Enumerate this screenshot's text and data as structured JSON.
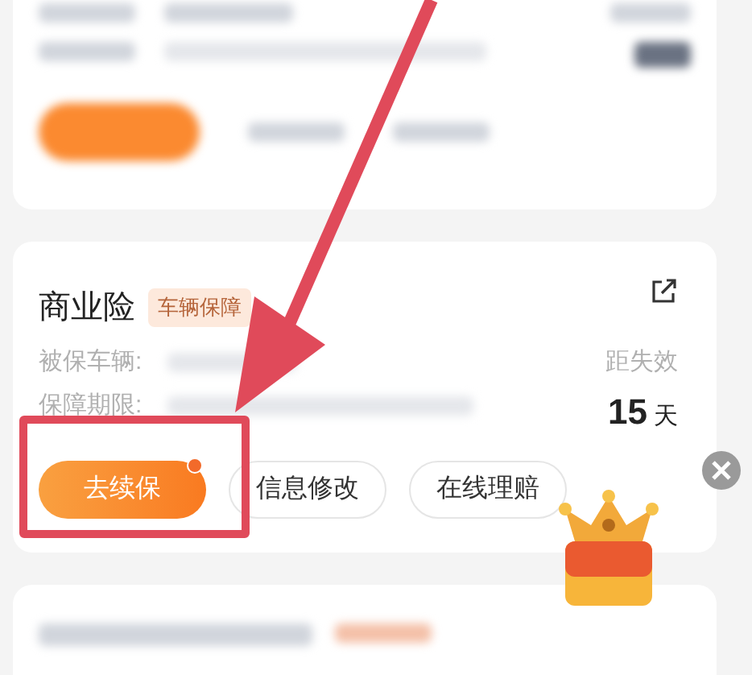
{
  "policy_card": {
    "title": "商业险",
    "tag": "车辆保障",
    "fields": [
      {
        "label": "被保车辆:"
      },
      {
        "label": "保障期限:"
      }
    ],
    "expiry_label": "距失效",
    "expiry_value": "15",
    "expiry_unit": "天",
    "buttons": [
      {
        "label": "去续保",
        "kind": "primary",
        "notification": true
      },
      {
        "label": "信息修改",
        "kind": "outline",
        "notification": false
      },
      {
        "label": "在线理赔",
        "kind": "outline",
        "notification": false
      }
    ]
  }
}
